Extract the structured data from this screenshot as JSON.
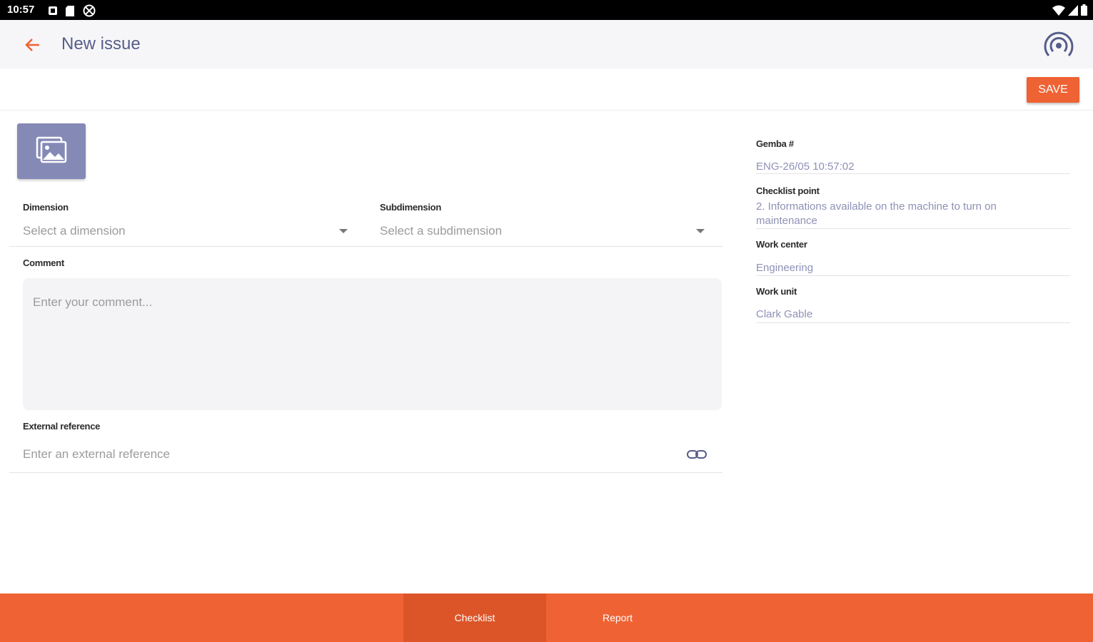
{
  "status_bar": {
    "time": "10:57"
  },
  "app_bar": {
    "title": "New issue"
  },
  "toolbar": {
    "save_label": "SAVE"
  },
  "form": {
    "dimension": {
      "label": "Dimension",
      "placeholder": "Select a dimension"
    },
    "subdimension": {
      "label": "Subdimension",
      "placeholder": "Select a subdimension"
    },
    "comment": {
      "label": "Comment",
      "placeholder": "Enter your comment..."
    },
    "external_reference": {
      "label": "External reference",
      "placeholder": "Enter an external reference"
    }
  },
  "details": {
    "gemba": {
      "label": "Gemba #",
      "value": "ENG-26/05 10:57:02"
    },
    "checklist_point": {
      "label": "Checklist point",
      "value": "2. Informations available on the machine to turn on maintenance"
    },
    "work_center": {
      "label": "Work center",
      "value": "Engineering"
    },
    "work_unit": {
      "label": "Work unit",
      "value": "Clark Gable"
    }
  },
  "bottom_nav": {
    "tabs": [
      {
        "label": "Checklist",
        "active": true
      },
      {
        "label": "Report",
        "active": false
      }
    ]
  },
  "colors": {
    "accent": "#ef6234",
    "title": "#565d8a",
    "photo_button": "#8589b6",
    "value_text": "#8e91b6"
  },
  "icons": [
    "back-arrow-icon",
    "radio-broadcast-icon",
    "gallery-icon",
    "dropdown-caret-icon",
    "link-icon",
    "notification-icon",
    "sd-card-icon",
    "blocked-icon",
    "wifi-icon",
    "signal-icon",
    "battery-icon"
  ]
}
